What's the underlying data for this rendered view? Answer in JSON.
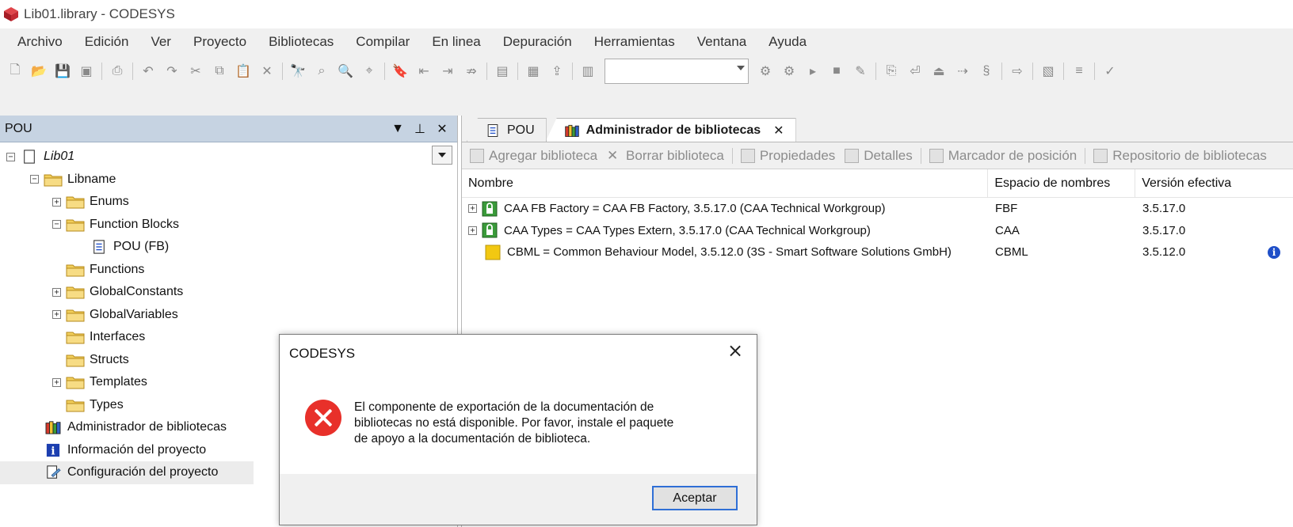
{
  "window": {
    "title": "Lib01.library - CODESYS"
  },
  "menu": [
    "Archivo",
    "Edición",
    "Ver",
    "Proyecto",
    "Bibliotecas",
    "Compilar",
    "En linea",
    "Depuración",
    "Herramientas",
    "Ventana",
    "Ayuda"
  ],
  "pou_panel": {
    "title": "POU",
    "tree": [
      {
        "label": "Lib01",
        "level": 0,
        "expander": "-",
        "icon": "document-icon",
        "italic": true
      },
      {
        "label": "Libname",
        "level": 1,
        "expander": "-",
        "icon": "folder-icon"
      },
      {
        "label": "Enums",
        "level": 2,
        "expander": "+",
        "icon": "folder-icon"
      },
      {
        "label": "Function Blocks",
        "level": 2,
        "expander": "-",
        "icon": "folder-icon"
      },
      {
        "label": "POU (FB)",
        "level": 3,
        "expander": "",
        "icon": "pou-document-icon"
      },
      {
        "label": "Functions",
        "level": 2,
        "expander": "",
        "icon": "folder-icon"
      },
      {
        "label": "GlobalConstants",
        "level": 2,
        "expander": "+",
        "icon": "folder-icon"
      },
      {
        "label": "GlobalVariables",
        "level": 2,
        "expander": "+",
        "icon": "folder-icon"
      },
      {
        "label": "Interfaces",
        "level": 2,
        "expander": "",
        "icon": "folder-icon"
      },
      {
        "label": "Structs",
        "level": 2,
        "expander": "",
        "icon": "folder-icon"
      },
      {
        "label": "Templates",
        "level": 2,
        "expander": "+",
        "icon": "folder-icon"
      },
      {
        "label": "Types",
        "level": 2,
        "expander": "",
        "icon": "folder-icon"
      },
      {
        "label": "Administrador de bibliotecas",
        "level": 1,
        "expander": "",
        "icon": "library-manager-icon"
      },
      {
        "label": "Información del proyecto",
        "level": 1,
        "expander": "",
        "icon": "info-icon"
      },
      {
        "label": "Configuración del proyecto",
        "level": 1,
        "expander": "",
        "icon": "settings-document-icon",
        "selected": true
      }
    ]
  },
  "tabs": [
    {
      "label": "POU",
      "active": false
    },
    {
      "label": "Administrador de bibliotecas",
      "active": true
    }
  ],
  "lib_toolbar": [
    "Agregar biblioteca",
    "Borrar biblioteca",
    "Propiedades",
    "Detalles",
    "Marcador de posición",
    "Repositorio de bibliotecas"
  ],
  "lib_table": {
    "headers": [
      "Nombre",
      "Espacio de nombres",
      "Versión efectiva"
    ],
    "rows": [
      {
        "name": "CAA FB Factory = CAA FB Factory, 3.5.17.0 (CAA Technical Workgroup)",
        "ns": "FBF",
        "version": "3.5.17.0",
        "expander": "+",
        "locked": true,
        "info": false
      },
      {
        "name": "CAA Types = CAA Types Extern, 3.5.17.0 (CAA Technical Workgroup)",
        "ns": "CAA",
        "version": "3.5.17.0",
        "expander": "+",
        "locked": true,
        "info": false
      },
      {
        "name": "CBML = Common Behaviour Model, 3.5.12.0 (3S - Smart Software Solutions GmbH)",
        "ns": "CBML",
        "version": "3.5.12.0",
        "expander": "",
        "locked": false,
        "info": true
      }
    ]
  },
  "dialog": {
    "title": "CODESYS",
    "message_lines": [
      "El componente de exportación de la documentación de",
      "bibliotecas no está disponible. Por favor, instale el paquete",
      "de apoyo a la documentación de biblioteca."
    ],
    "ok_label": "Aceptar"
  },
  "colors": {
    "panel_header": "#c6d3e2",
    "error_red": "#e8302a",
    "focus_blue": "#2f6fd6",
    "folder_yellow": "#f2cf5b"
  }
}
